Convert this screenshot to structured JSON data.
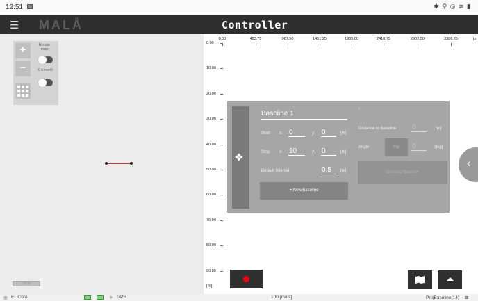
{
  "status_bar": {
    "time": "12:51",
    "system_icons": "✱ ⚲ ◎ ≋ ▮"
  },
  "app_bar": {
    "menu_icon": "menu-icon",
    "brand": "MALÅ",
    "title": "Controller"
  },
  "map": {
    "zoom_in": "+",
    "zoom_out": "−",
    "rotate_map_label": "Rotate map",
    "rotate_map_on": false,
    "x_north_label": "X is north",
    "x_north_on": false,
    "scale_label": "10 m"
  },
  "plot": {
    "x_ticks": [
      "0.00",
      "483.75",
      "967.50",
      "1451.25",
      "1935.00",
      "2418.75",
      "2902.50",
      "3386.25",
      "|m"
    ],
    "y_ticks": [
      "0.00",
      "10.00",
      "20.00",
      "30.00",
      "40.00",
      "50.00",
      "60.00",
      "70.00",
      "80.00",
      "90.00"
    ],
    "unit_label": "[m]"
  },
  "baseline_dialog": {
    "name": "Baseline 1",
    "dash": "-",
    "start_label": "Start",
    "stop_label": "Stop",
    "x_label": "x:",
    "y_label": "y:",
    "unit_m": "[m]",
    "start_x": "0",
    "start_y": "0",
    "stop_x": "10",
    "stop_y": "0",
    "default_interval_label": "Default Interval",
    "default_interval": "0.5",
    "new_baseline_label": "+ New Baseline",
    "distance_label": "Distance to baseline",
    "distance_value": "0",
    "angle_label": "Angle",
    "flip_label": "Flip",
    "angle_value": "0",
    "unit_deg": "[deg]",
    "crossing_label": "Crossing Baseline"
  },
  "bottom_bar": {
    "el_core": "EL Core",
    "gps": "GPS",
    "speed": "100 [m/us]",
    "project": "ProjBaseline(14) ·· ⊠"
  }
}
